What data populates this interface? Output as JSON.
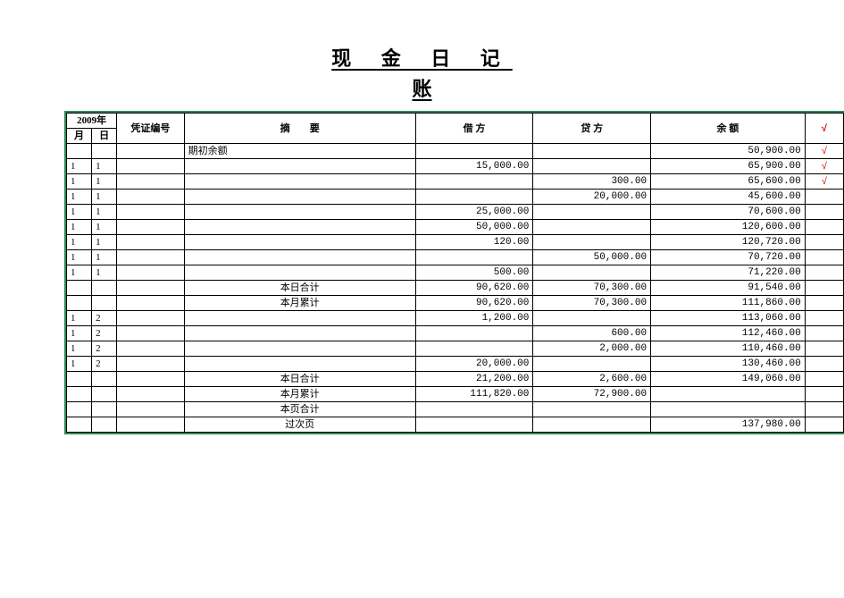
{
  "title_line1": "现 金 日 记",
  "title_line2": "账",
  "header": {
    "year": "2009年",
    "month": "月",
    "day": "日",
    "voucher": "凭证编号",
    "summary_a": "摘",
    "summary_b": "要",
    "debit": "借 方",
    "credit": "贷 方",
    "balance": "余 额",
    "check": "√"
  },
  "rows": [
    {
      "m": "",
      "d": "",
      "v": "",
      "s": "期初余额",
      "sA": "left",
      "dr": "",
      "cr": "",
      "bal": "50,900.00",
      "ck": "√"
    },
    {
      "m": "1",
      "d": "1",
      "v": "",
      "s": "",
      "sA": "left",
      "dr": "15,000.00",
      "cr": "",
      "bal": "65,900.00",
      "ck": "√"
    },
    {
      "m": "1",
      "d": "1",
      "v": "",
      "s": "",
      "sA": "left",
      "dr": "",
      "cr": "300.00",
      "bal": "65,600.00",
      "ck": "√"
    },
    {
      "m": "1",
      "d": "1",
      "v": "",
      "s": "",
      "sA": "left",
      "dr": "",
      "cr": "20,000.00",
      "bal": "45,600.00",
      "ck": ""
    },
    {
      "m": "1",
      "d": "1",
      "v": "",
      "s": "",
      "sA": "left",
      "dr": "25,000.00",
      "cr": "",
      "bal": "70,600.00",
      "ck": ""
    },
    {
      "m": "1",
      "d": "1",
      "v": "",
      "s": "",
      "sA": "left",
      "dr": "50,000.00",
      "cr": "",
      "bal": "120,600.00",
      "ck": ""
    },
    {
      "m": "1",
      "d": "1",
      "v": "",
      "s": "",
      "sA": "left",
      "dr": "120.00",
      "cr": "",
      "bal": "120,720.00",
      "ck": ""
    },
    {
      "m": "1",
      "d": "1",
      "v": "",
      "s": "",
      "sA": "left",
      "dr": "",
      "cr": "50,000.00",
      "bal": "70,720.00",
      "ck": ""
    },
    {
      "m": "1",
      "d": "1",
      "v": "",
      "s": "",
      "sA": "left",
      "dr": "500.00",
      "cr": "",
      "bal": "71,220.00",
      "ck": ""
    },
    {
      "m": "",
      "d": "",
      "v": "",
      "s": "本日合计",
      "sA": "center",
      "dr": "90,620.00",
      "cr": "70,300.00",
      "bal": "91,540.00",
      "ck": ""
    },
    {
      "m": "",
      "d": "",
      "v": "",
      "s": "本月累计",
      "sA": "center",
      "dr": "90,620.00",
      "cr": "70,300.00",
      "bal": "111,860.00",
      "ck": ""
    },
    {
      "m": "1",
      "d": "2",
      "v": "",
      "s": "",
      "sA": "left",
      "dr": "1,200.00",
      "cr": "",
      "bal": "113,060.00",
      "ck": ""
    },
    {
      "m": "1",
      "d": "2",
      "v": "",
      "s": "",
      "sA": "left",
      "dr": "",
      "cr": "600.00",
      "bal": "112,460.00",
      "ck": ""
    },
    {
      "m": "1",
      "d": "2",
      "v": "",
      "s": "",
      "sA": "left",
      "dr": "",
      "cr": "2,000.00",
      "bal": "110,460.00",
      "ck": ""
    },
    {
      "m": "1",
      "d": "2",
      "v": "",
      "s": "",
      "sA": "left",
      "dr": "20,000.00",
      "cr": "",
      "bal": "130,460.00",
      "ck": ""
    },
    {
      "m": "",
      "d": "",
      "v": "",
      "s": "本日合计",
      "sA": "center",
      "dr": "21,200.00",
      "cr": "2,600.00",
      "bal": "149,060.00",
      "ck": ""
    },
    {
      "m": "",
      "d": "",
      "v": "",
      "s": "本月累计",
      "sA": "center",
      "dr": "111,820.00",
      "cr": "72,900.00",
      "bal": "",
      "ck": ""
    },
    {
      "m": "",
      "d": "",
      "v": "",
      "s": "本页合计",
      "sA": "center",
      "dr": "",
      "cr": "",
      "bal": "",
      "ck": ""
    },
    {
      "m": "",
      "d": "",
      "v": "",
      "s": "过次页",
      "sA": "center",
      "dr": "",
      "cr": "",
      "bal": "137,980.00",
      "ck": ""
    }
  ]
}
